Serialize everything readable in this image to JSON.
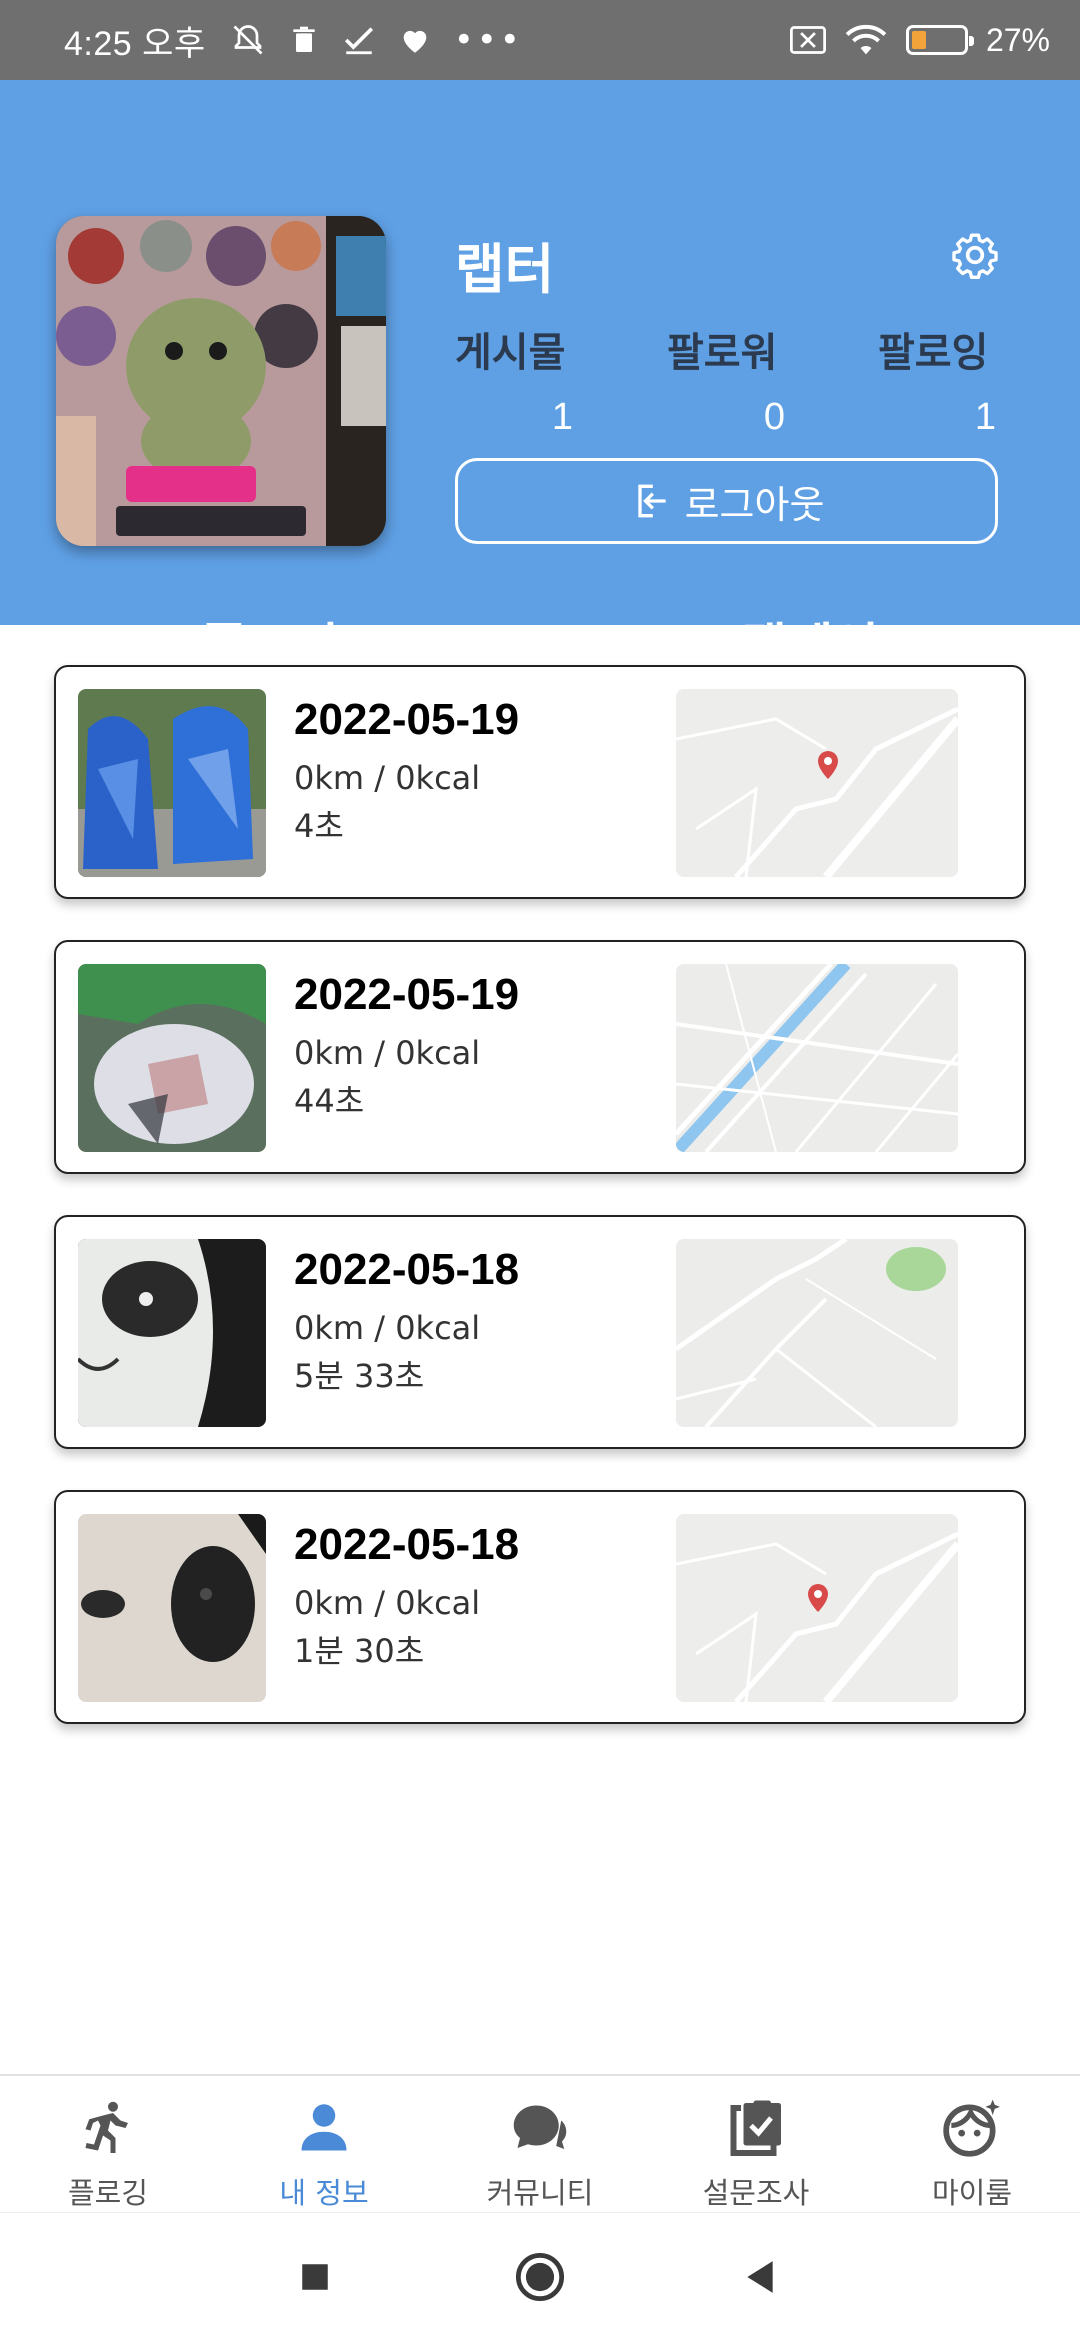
{
  "status_bar": {
    "time": "4:25 오후",
    "battery_percent": "27%",
    "battery_level": 0.27,
    "icons_left": [
      "do-not-disturb-icon",
      "trash-icon",
      "check-icon",
      "heart-icon",
      "more-icon"
    ],
    "icons_right": [
      "sim-off-icon",
      "wifi-icon",
      "battery-icon"
    ]
  },
  "profile": {
    "username": "랩터",
    "avatar_icon": "profile-photo",
    "stats": [
      {
        "label": "게시물",
        "value": "1"
      },
      {
        "label": "팔로워",
        "value": "0"
      },
      {
        "label": "팔로잉",
        "value": "1"
      }
    ],
    "logout_label": "로그아웃",
    "settings_icon": "gear-icon"
  },
  "tabs": [
    {
      "label": "플로깅",
      "active": true
    },
    {
      "label": "캠페인",
      "active": false
    }
  ],
  "records": [
    {
      "date": "2022-05-19",
      "stats": "0km / 0kcal",
      "duration": "4초"
    },
    {
      "date": "2022-05-19",
      "stats": "0km / 0kcal",
      "duration": "44초"
    },
    {
      "date": "2022-05-18",
      "stats": "0km / 0kcal",
      "duration": "5분 33초"
    },
    {
      "date": "2022-05-18",
      "stats": "0km / 0kcal",
      "duration": "1분 30초"
    }
  ],
  "bottom_nav": [
    {
      "label": "플로깅",
      "icon": "running-icon",
      "active": false
    },
    {
      "label": "내 정보",
      "icon": "person-icon",
      "active": true
    },
    {
      "label": "커뮤니티",
      "icon": "chat-icon",
      "active": false
    },
    {
      "label": "설문조사",
      "icon": "clipboard-check-icon",
      "active": false
    },
    {
      "label": "마이룸",
      "icon": "face-icon",
      "active": false
    }
  ],
  "colors": {
    "header_bg": "#5fa0e5",
    "nav_active": "#4a8ad6",
    "stat_label": "#2b3a4e"
  }
}
